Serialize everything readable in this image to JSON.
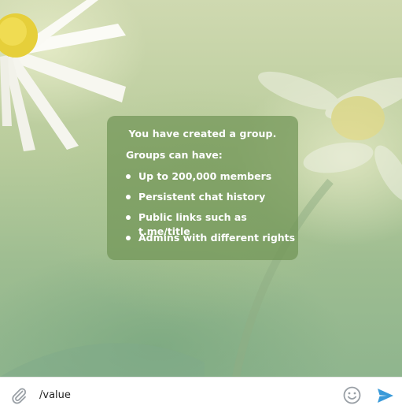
{
  "service_message": {
    "title": "You have created a group.",
    "subtitle": "Groups can have:",
    "features": [
      "Up to 200,000 members",
      "Persistent chat history",
      "Public links such as t.me/title",
      "Admins with different rights"
    ]
  },
  "composer": {
    "input_value": "/value",
    "attach_icon": "paperclip-icon",
    "emoji_icon": "smiley-icon",
    "send_icon": "send-arrow-icon"
  },
  "colors": {
    "accent": "#3a9ad9",
    "icon_gray": "#9aa0a6",
    "card_bg": "#709456"
  }
}
